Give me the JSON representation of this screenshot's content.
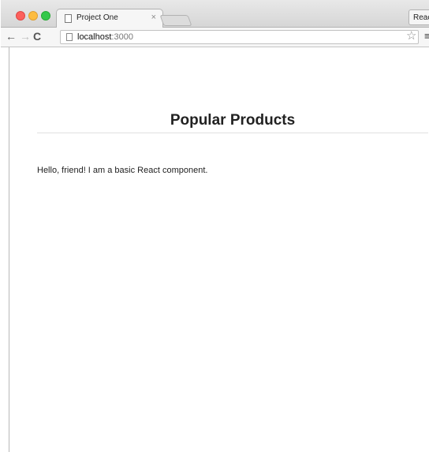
{
  "browser": {
    "tab_title": "Project One",
    "tab_close": "×",
    "extension_label": "Reac",
    "address_host": "localhost",
    "address_port": ":3000",
    "icons": {
      "back": "←",
      "forward": "→",
      "reload": "C",
      "star": "☆",
      "menu": "≡"
    }
  },
  "page": {
    "heading": "Popular Products",
    "body_text": "Hello, friend! I am a basic React component."
  }
}
